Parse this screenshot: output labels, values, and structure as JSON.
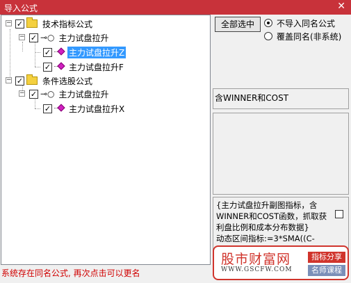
{
  "window": {
    "title": "导入公式",
    "close_glyph": "✕"
  },
  "tree": {
    "nodes": [
      {
        "label": "技术指标公式",
        "checked": true,
        "expander": "−"
      },
      {
        "label": "主力试盘拉升",
        "checked": true,
        "expander": "−"
      },
      {
        "label": "主力试盘拉升Z",
        "checked": true,
        "selected": true
      },
      {
        "label": "主力试盘拉升F",
        "checked": true
      },
      {
        "label": "条件选股公式",
        "checked": true,
        "expander": "−"
      },
      {
        "label": "主力试盘拉升",
        "checked": true,
        "expander": "−"
      },
      {
        "label": "主力试盘拉升X",
        "checked": true
      }
    ],
    "check_glyph": "✓",
    "key_glyph": "⊸○"
  },
  "actions": {
    "select_all_label": "全部选中"
  },
  "options": {
    "no_import_label": "不导入同名公式",
    "overwrite_label": "覆盖同名(非系统)"
  },
  "info": {
    "header_text": "含WINNER和COST",
    "description": "{主力试盘拉升副图指标，含WINNER和COST函数，抓取获利盘比例和成本分布数据}\n动态区间指标:=3*SMA((C-"
  },
  "watermark": {
    "site_name": "股市财富网",
    "url": "WWW.GSCFW.COM",
    "tag1": "指标分享",
    "tag2": "名师课程"
  },
  "status": {
    "message": "系统存在同名公式, 再次点击可以更名"
  },
  "colors": {
    "titlebar": "#c8323a",
    "selection": "#3399ff",
    "status_text": "#d00000",
    "accent": "#d0342c"
  }
}
